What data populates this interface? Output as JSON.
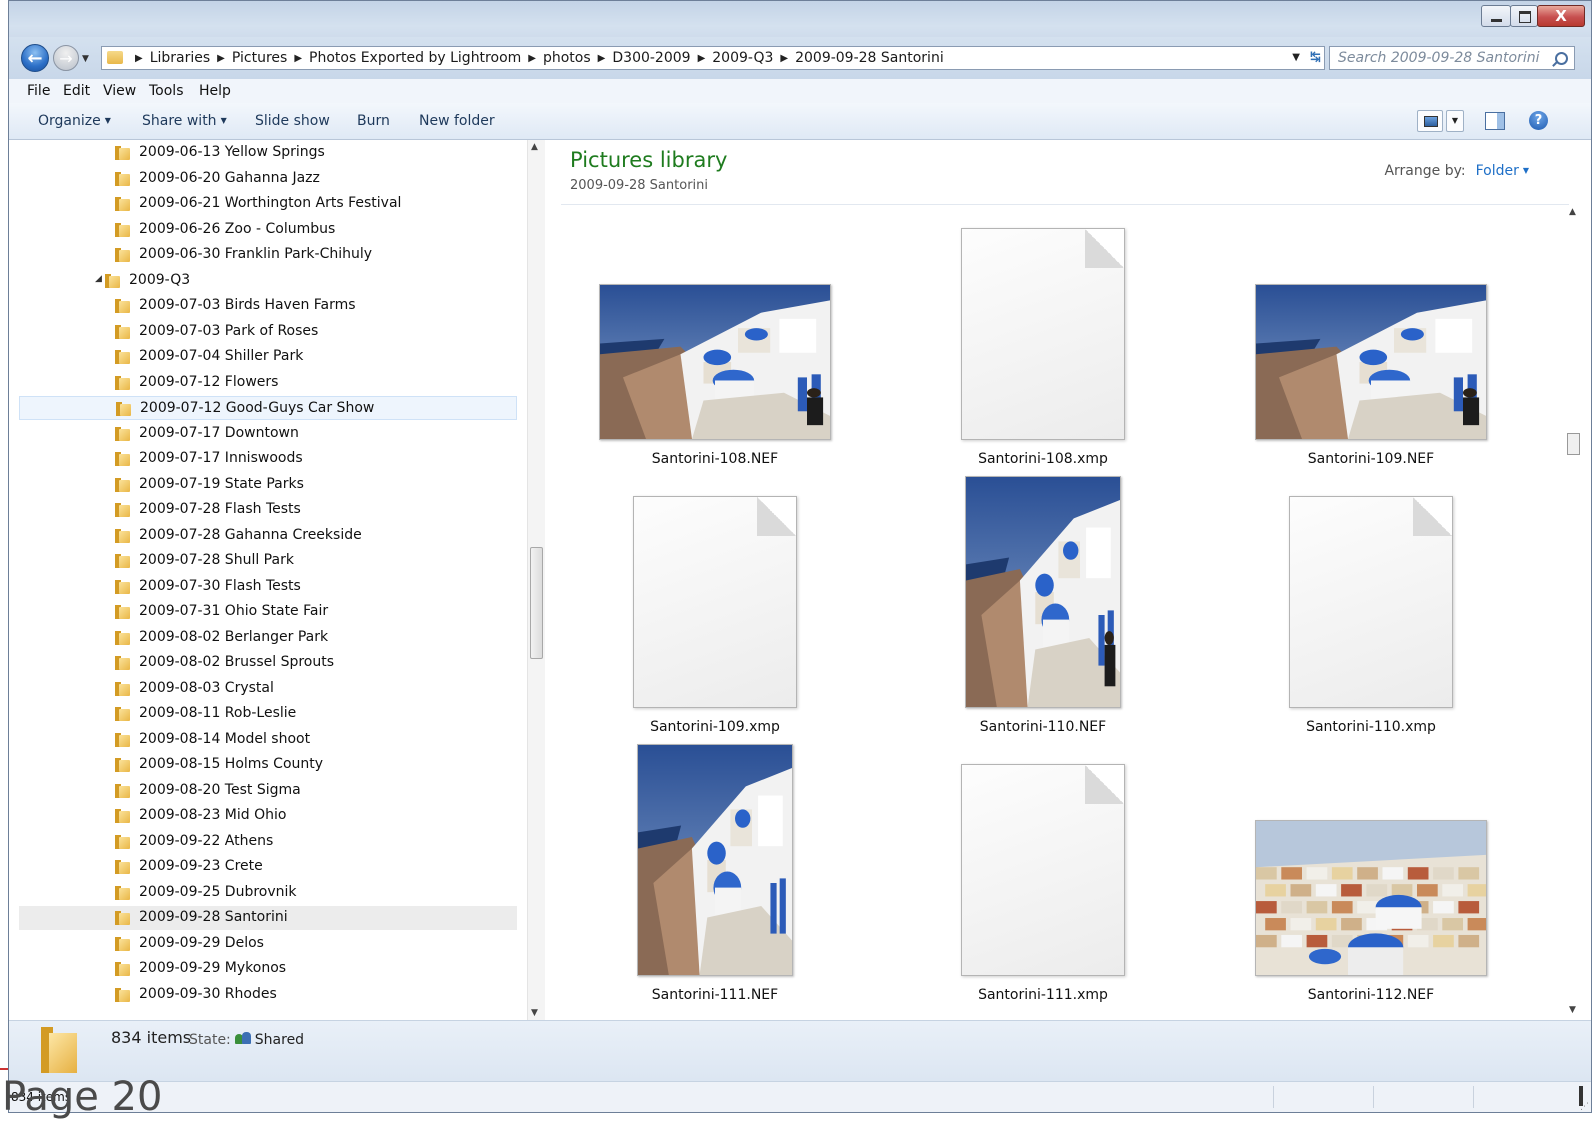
{
  "window": {
    "close_glyph": "X"
  },
  "nav": {
    "back_glyph": "←",
    "forward_glyph": "→",
    "dropdown_glyph": "▼"
  },
  "address": {
    "crumbs": [
      "Libraries",
      "Pictures",
      "Photos Exported by Lightroom",
      "photos",
      "D300-2009",
      "2009-Q3",
      "2009-09-28 Santorini"
    ],
    "separator": "▶",
    "dropdown_glyph": "▼",
    "refresh_glyph": "↹"
  },
  "search": {
    "placeholder": "Search 2009-09-28 Santorini"
  },
  "menu": {
    "items": [
      "File",
      "Edit",
      "View",
      "Tools",
      "Help"
    ]
  },
  "toolbar": {
    "organize": "Organize",
    "share_with": "Share with",
    "slide_show": "Slide show",
    "burn": "Burn",
    "new_folder": "New folder",
    "caret": "▼",
    "help_glyph": "?"
  },
  "tree": {
    "expand_glyph": "◢",
    "items": [
      {
        "label": "2009-06-13 Yellow Springs",
        "level": 2
      },
      {
        "label": "2009-06-20 Gahanna Jazz",
        "level": 2
      },
      {
        "label": "2009-06-21 Worthington Arts Festival",
        "level": 2
      },
      {
        "label": "2009-06-26 Zoo - Columbus",
        "level": 2
      },
      {
        "label": "2009-06-30 Franklin Park-Chihuly",
        "level": 2
      },
      {
        "label": "2009-Q3",
        "level": 1,
        "expanded": true
      },
      {
        "label": "2009-07-03 Birds Haven Farms",
        "level": 2
      },
      {
        "label": "2009-07-03 Park of Roses",
        "level": 2
      },
      {
        "label": "2009-07-04 Shiller Park",
        "level": 2
      },
      {
        "label": "2009-07-12 Flowers",
        "level": 2
      },
      {
        "label": "2009-07-12 Good-Guys Car Show",
        "level": 2,
        "state": "hover"
      },
      {
        "label": "2009-07-17 Downtown",
        "level": 2
      },
      {
        "label": "2009-07-17 Inniswoods",
        "level": 2
      },
      {
        "label": "2009-07-19 State Parks",
        "level": 2
      },
      {
        "label": "2009-07-28 Flash Tests",
        "level": 2
      },
      {
        "label": "2009-07-28 Gahanna Creekside",
        "level": 2
      },
      {
        "label": "2009-07-28 Shull Park",
        "level": 2
      },
      {
        "label": "2009-07-30 Flash Tests",
        "level": 2
      },
      {
        "label": "2009-07-31 Ohio State Fair",
        "level": 2
      },
      {
        "label": "2009-08-02 Berlanger Park",
        "level": 2
      },
      {
        "label": "2009-08-02 Brussel Sprouts",
        "level": 2
      },
      {
        "label": "2009-08-03 Crystal",
        "level": 2
      },
      {
        "label": "2009-08-11 Rob-Leslie",
        "level": 2
      },
      {
        "label": "2009-08-14 Model shoot",
        "level": 2
      },
      {
        "label": "2009-08-15 Holms County",
        "level": 2
      },
      {
        "label": "2009-08-20 Test Sigma",
        "level": 2
      },
      {
        "label": "2009-08-23 Mid Ohio",
        "level": 2
      },
      {
        "label": "2009-09-22 Athens",
        "level": 2
      },
      {
        "label": "2009-09-23 Crete",
        "level": 2
      },
      {
        "label": "2009-09-25 Dubrovnik",
        "level": 2
      },
      {
        "label": "2009-09-28 Santorini",
        "level": 2,
        "state": "selected"
      },
      {
        "label": "2009-09-29 Delos",
        "level": 2
      },
      {
        "label": "2009-09-29 Mykonos",
        "level": 2
      },
      {
        "label": "2009-09-30 Rhodes",
        "level": 2
      }
    ]
  },
  "scroll": {
    "up_glyph": "▲",
    "down_glyph": "▼",
    "grip_glyph": "≡"
  },
  "library": {
    "title": "Pictures library",
    "subtitle": "2009-09-28 Santorini",
    "arrange_label": "Arrange by:",
    "arrange_value": "Folder",
    "caret": "▼"
  },
  "files": [
    {
      "name": "Santorini-108.NEF",
      "kind": "photo-landscape",
      "scene": "cliff"
    },
    {
      "name": "Santorini-108.xmp",
      "kind": "doc"
    },
    {
      "name": "Santorini-109.NEF",
      "kind": "photo-landscape",
      "scene": "cliff"
    },
    {
      "name": "Santorini-109.xmp",
      "kind": "doc"
    },
    {
      "name": "Santorini-110.NEF",
      "kind": "photo-portrait",
      "scene": "cliff"
    },
    {
      "name": "Santorini-110.xmp",
      "kind": "doc"
    },
    {
      "name": "Santorini-111.NEF",
      "kind": "photo-portrait",
      "scene": "church"
    },
    {
      "name": "Santorini-111.xmp",
      "kind": "doc"
    },
    {
      "name": "Santorini-112.NEF",
      "kind": "photo-landscape",
      "scene": "village"
    }
  ],
  "details": {
    "count": "834 items",
    "state_label": "State:",
    "state_value": "Shared"
  },
  "statusbar": {
    "text": "834 items",
    "grip": "⋰"
  },
  "page_label": "Page 20"
}
